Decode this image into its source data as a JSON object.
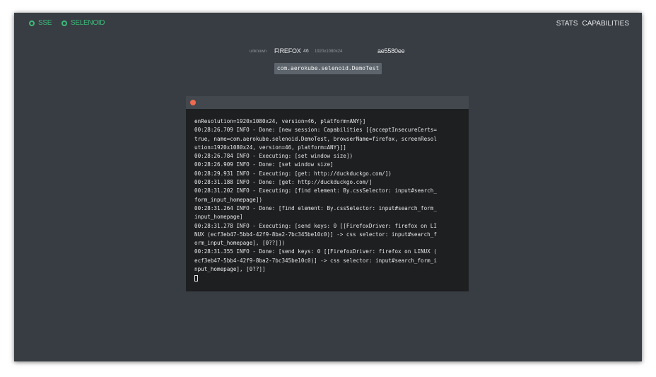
{
  "topbar": {
    "status_sse": "SSE",
    "status_selenoid": "SELENOID",
    "nav_stats": "STATS",
    "nav_capabilities": "CAPABILITIES",
    "status_color": "#3dba7a"
  },
  "session": {
    "unknown_label": "unknown",
    "browser": "FIREFOX",
    "version": "46",
    "resolution": "1920x1080x24",
    "session_id": "ae5580ee"
  },
  "test_name": "com.aerokube.selenoid.DemoTest",
  "log": {
    "close_color": "#f06a50",
    "lines": [
      "enResolution=1920x1080x24, version=46, platform=ANY}]",
      "00:28:26.709 INFO - Done: [new session: Capabilities [{acceptInsecureCerts=",
      "true, name=com.aerokube.selenoid.DemoTest, browserName=firefox, screenResol",
      "ution=1920x1080x24, version=46, platform=ANY}]]",
      "00:28:26.784 INFO - Executing: [set window size])",
      "00:28:26.909 INFO - Done: [set window size]",
      "00:28:29.931 INFO - Executing: [get: http://duckduckgo.com/])",
      "00:28:31.188 INFO - Done: [get: http://duckduckgo.com/]",
      "00:28:31.202 INFO - Executing: [find element: By.cssSelector: input#search_",
      "form_input_homepage])",
      "00:28:31.264 INFO - Done: [find element: By.cssSelector: input#search_form_",
      "input_homepage]",
      "00:28:31.278 INFO - Executing: [send keys: 0 [[FirefoxDriver: firefox on LI",
      "NUX (ecf3eb47-5bb4-42f9-8ba2-7bc345be10c0)] -> css selector: input#search_f",
      "orm_input_homepage], [0??]])",
      "00:28:31.355 INFO - Done: [send keys: 0 [[FirefoxDriver: firefox on LINUX (",
      "ecf3eb47-5bb4-42f9-8ba2-7bc345be10c0)] -> css selector: input#search_form_i",
      "nput_homepage], [0??]]"
    ]
  }
}
